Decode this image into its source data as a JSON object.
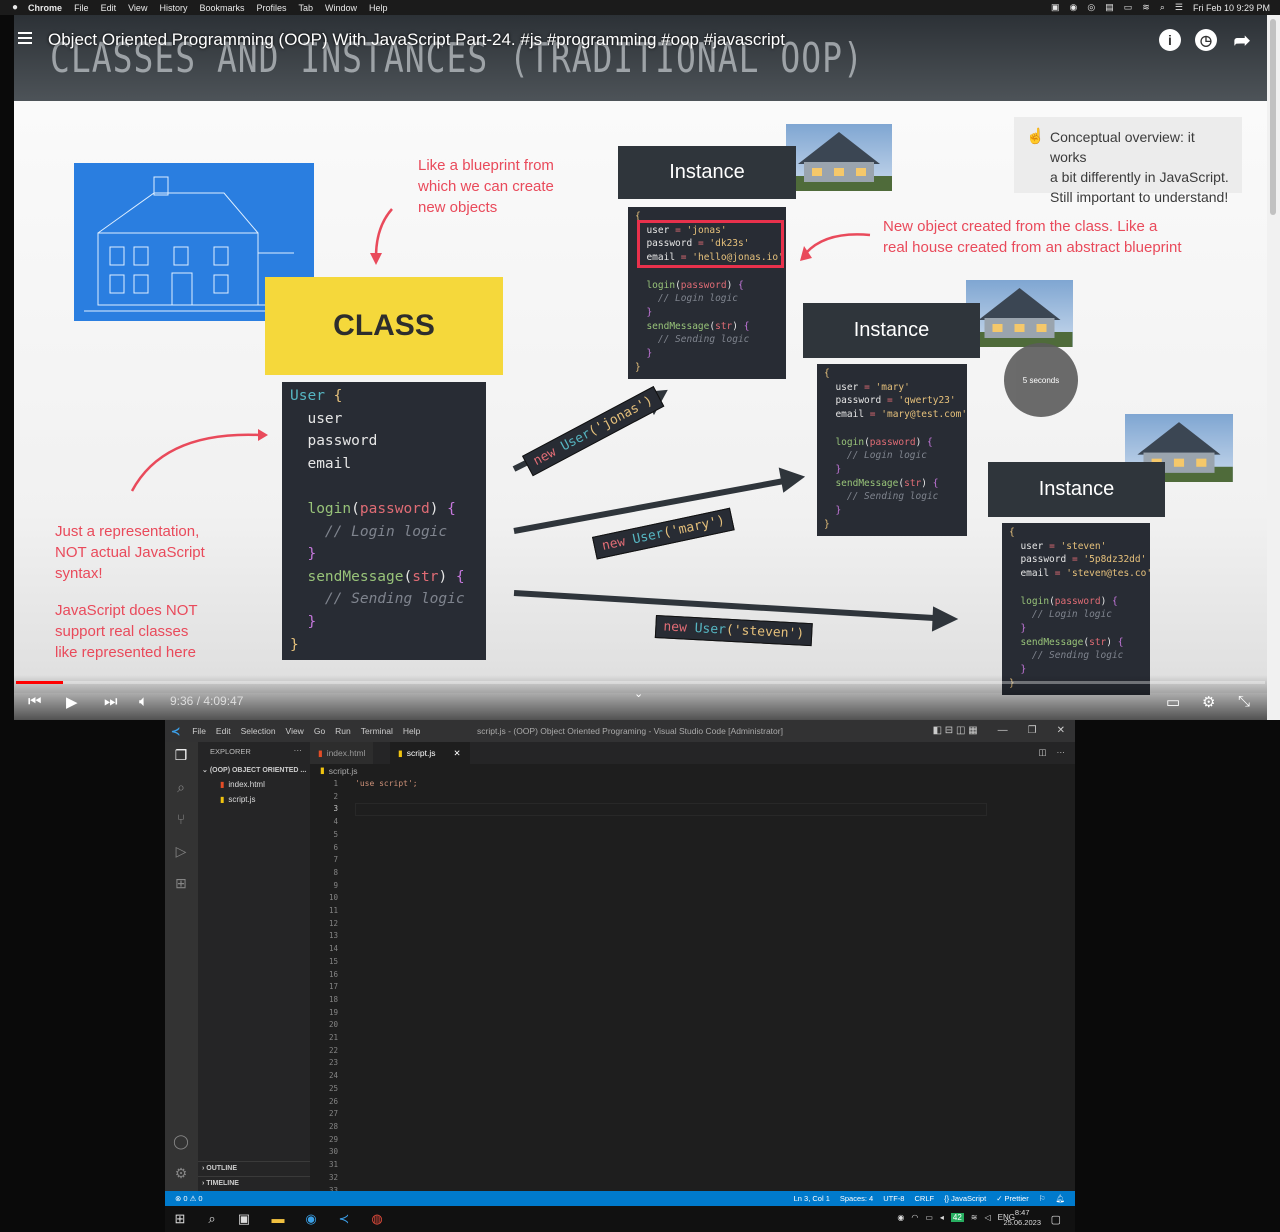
{
  "macos": {
    "apple": "",
    "app": "Chrome",
    "menu": [
      "File",
      "Edit",
      "View",
      "History",
      "Bookmarks",
      "Profiles",
      "Tab",
      "Window",
      "Help"
    ],
    "clock": "Fri Feb 10  9:29 PM"
  },
  "youtube": {
    "title": "Object Oriented Programming (OOP) With JavaScript Part-24. #js #programming #oop #javascript",
    "time": "9:36 / 4:09:47",
    "progress_percent": 3.8
  },
  "slide": {
    "heading": "CLASSES AND INSTANCES (TRADITIONAL OOP)",
    "blueprint_note": [
      "Like a blueprint from",
      "which we can create",
      "new objects"
    ],
    "class_label": "CLASS",
    "concept": {
      "hand": "☝",
      "lines": [
        "Conceptual overview: it works",
        "a bit differently in JavaScript.",
        "Still important to understand!"
      ]
    },
    "object_note": [
      "New object created from the class. Like a",
      "real house created from an abstract blueprint"
    ],
    "representation_note": [
      "Just a representation,",
      "NOT actual JavaScript",
      "syntax!"
    ],
    "js_note": [
      "JavaScript does NOT",
      "support real classes",
      "like represented here"
    ],
    "class_code": {
      "class": "User",
      "brace_open": "{",
      "fields": [
        "user",
        "password",
        "email"
      ],
      "login": "login",
      "login_param": "password",
      "login_comment": "// Login logic",
      "send": "sendMessage",
      "send_param": "str",
      "send_comment": "// Sending logic",
      "close_inner": "}",
      "close": "}",
      "open": "{"
    },
    "instance_label": "Instance",
    "instances": [
      {
        "user": "'jonas'",
        "password": "'dk23s'",
        "email": "'hello@jonas.io'",
        "new": "new",
        "cls": "User",
        "arg": "('jonas')"
      },
      {
        "user": "'mary'",
        "password": "'qwerty23'",
        "email": "'mary@test.com'",
        "new": "new",
        "cls": "User",
        "arg": "('mary')"
      },
      {
        "user": "'steven'",
        "password": "'5p8dz32dd'",
        "email": "'steven@tes.co'",
        "new": "new",
        "cls": "User",
        "arg": "('steven')"
      }
    ],
    "inst_keys": {
      "user": "user",
      "password": "password",
      "email": "email",
      "eq": "=",
      "login": "login",
      "login_param": "password",
      "login_comment": "// Login logic",
      "send": "sendMessage",
      "send_param": "str",
      "send_comment": "// Sending logic",
      "open": "{",
      "close": "}"
    },
    "timer": "5 seconds"
  },
  "vscode": {
    "menu": [
      "File",
      "Edit",
      "Selection",
      "View",
      "Go",
      "Run",
      "Terminal",
      "Help"
    ],
    "window_title": "script.js - (OOP) Object Oriented Programing - Visual Studio Code [Administrator]",
    "explorer": "EXPLORER",
    "folder": "(OOP) OBJECT ORIENTED ...",
    "files": [
      "index.html",
      "script.js"
    ],
    "outline": "OUTLINE",
    "timeline": "TIMELINE",
    "tabs": [
      "index.html",
      "script.js"
    ],
    "breadcrumb": "script.js",
    "code_line1": "'use script';",
    "line_count": 33,
    "status_left": "⊗ 0 ⚠ 0",
    "status_right": [
      "Ln 3, Col 1",
      "Spaces: 4",
      "UTF-8",
      "CRLF",
      "{} JavaScript",
      "✓ Prettier"
    ]
  },
  "taskbar": {
    "lang": "ENG",
    "time": "8:47",
    "date": "25.06.2023",
    "badge": "42"
  }
}
